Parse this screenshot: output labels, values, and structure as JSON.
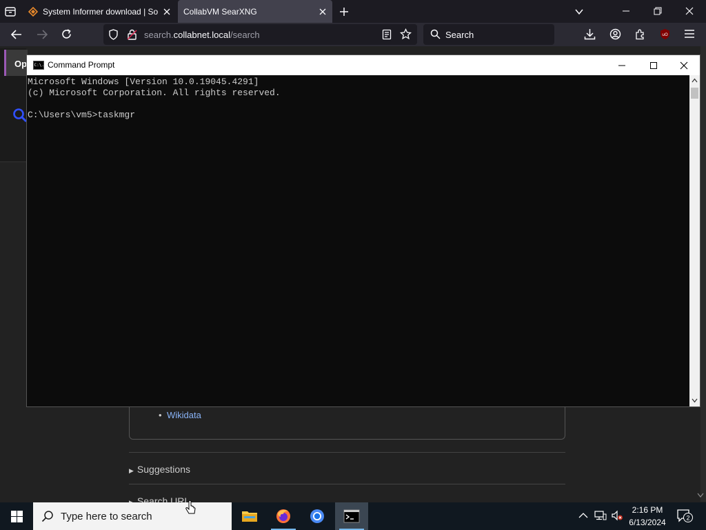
{
  "browser": {
    "tabs": [
      {
        "title": "System Informer download | So",
        "active": false
      },
      {
        "title": "CollabVM SearXNG",
        "active": true
      }
    ],
    "url_prefix": "search.",
    "url_domain": "collabnet.local",
    "url_path": "/search",
    "search_placeholder": "Search",
    "ublock_badge": "uO"
  },
  "page": {
    "side_tab_label": "Op",
    "link_wikidata": "Wikidata",
    "suggestions_label": "Suggestions",
    "search_url_label": "Search URL"
  },
  "cmd": {
    "title": "Command Prompt",
    "icon_text": "C:\\.",
    "lines": [
      "Microsoft Windows [Version 10.0.19045.4291]",
      "(c) Microsoft Corporation. All rights reserved.",
      "",
      "C:\\Users\\vm5>taskmgr"
    ]
  },
  "taskbar": {
    "search_placeholder": "Type here to search",
    "time": "2:16 PM",
    "date": "6/13/2024",
    "notification_count": "2"
  },
  "colors": {
    "cmd_bg": "#0c0c0c",
    "cmd_text": "#cccccc",
    "link": "#8ab4f8",
    "taskbar": "#101820",
    "ublock": "#800000"
  }
}
